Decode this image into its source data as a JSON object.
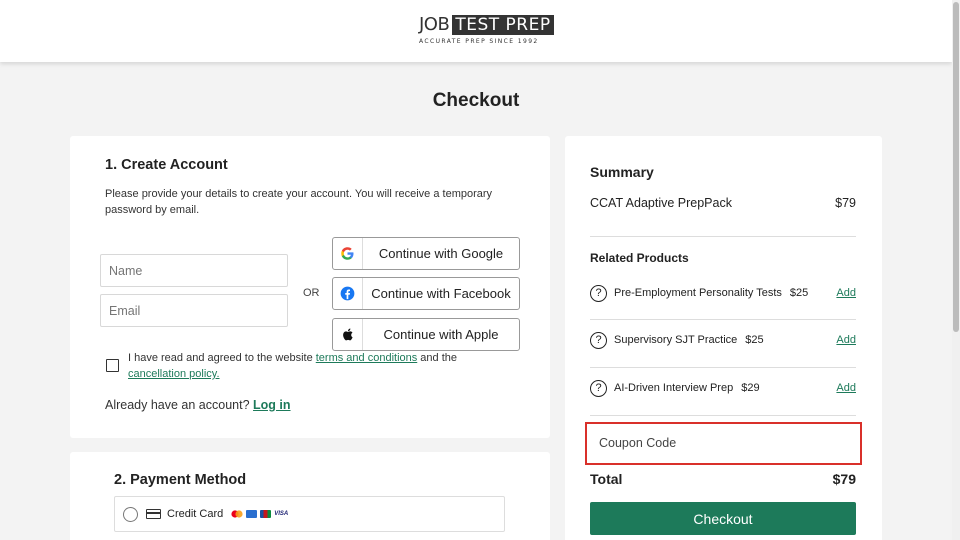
{
  "header": {
    "logo": {
      "job": "JOB",
      "testprep": "TEST PREP",
      "tagline": "ACCURATE PREP SINCE 1992"
    }
  },
  "page": {
    "title": "Checkout"
  },
  "account": {
    "title": "1. Create Account",
    "description": "Please provide your details to create your account. You will receive a temporary password by email.",
    "name_placeholder": "Name",
    "email_placeholder": "Email",
    "or_label": "OR",
    "google_label": "Continue with Google",
    "facebook_label": "Continue with Facebook",
    "apple_label": "Continue with Apple",
    "agree_prefix": "I have read and agreed to the website ",
    "terms_link": "terms and conditions",
    "agree_middle": " and the ",
    "cancellation_link": "cancellation policy.",
    "already_text": "Already have an account? ",
    "login_link": "Log in"
  },
  "payment": {
    "title": "2. Payment Method",
    "credit_card_label": "Credit Card",
    "brands": [
      "mastercard",
      "amex",
      "jcb",
      "visa"
    ],
    "visa_text": "VISA"
  },
  "summary": {
    "title": "Summary",
    "product": "CCAT Adaptive PrepPack",
    "product_price": "$79",
    "related_title": "Related Products",
    "related": [
      {
        "name": "Pre-Employment Personality Tests",
        "price": "$25",
        "add": "Add"
      },
      {
        "name": "Supervisory SJT Practice",
        "price": "$25",
        "add": "Add"
      },
      {
        "name": "AI-Driven Interview Prep",
        "price": "$29",
        "add": "Add"
      }
    ],
    "coupon_placeholder": "Coupon Code",
    "total_label": "Total",
    "total_value": "$79",
    "checkout_label": "Checkout"
  },
  "colors": {
    "accent": "#1d7a5a",
    "highlight": "#d9302a"
  },
  "icons": {
    "help": "?",
    "google": "google-icon",
    "facebook": "facebook-icon",
    "apple": "apple-icon"
  }
}
